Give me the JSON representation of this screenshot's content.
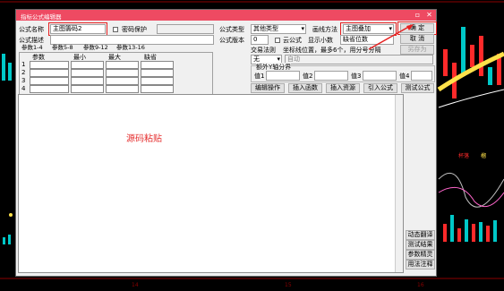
{
  "dialog": {
    "title": "指标公式编辑器",
    "close_glyph": "✕",
    "formula_name_label": "公式名称",
    "formula_name_value": "主图籌码2",
    "password_label": "密码保护",
    "formula_type_label": "公式类型",
    "formula_type_value": "其他类型",
    "draw_method_label": "画线方法",
    "draw_method_value": "主图叠加",
    "ok_button": "确  定",
    "cancel_button": "取  消",
    "save_as_button": "另存为",
    "formula_desc_label": "公式描述",
    "version_label": "公式版本",
    "version_value": "0",
    "cloud_label": "云公式",
    "display_decimals_label": "显示小数",
    "display_decimals_value": "缺省位数",
    "trade_rule_label": "交易法则",
    "coord_label": "坐标线位置，最多6个，用分号分隔",
    "trade_rule_value": "无",
    "auto_label": "自动",
    "extra_y_label": "额外Y轴分界",
    "values": [
      "值1",
      "值2",
      "值3",
      "值4"
    ],
    "tabs": [
      "参数1-4",
      "参数5-8",
      "参数9-12",
      "参数13-16"
    ],
    "param_headers": [
      "参数",
      "最小",
      "最大",
      "缺省"
    ],
    "param_rows": [
      "1",
      "2",
      "3",
      "4"
    ],
    "toolbar": [
      "编辑操作",
      "插入函数",
      "插入资源",
      "引入公式",
      "测试公式"
    ],
    "editor_text": "源码粘贴",
    "side_buttons": [
      "动态翻译",
      "测试结果",
      "参数精灵",
      "用法注释"
    ]
  },
  "background": {
    "axis_labels": [
      "14",
      "15",
      "16"
    ],
    "chart_labels": [
      "杯落",
      "榴"
    ]
  },
  "colors": {
    "accent_red": "#e52020",
    "title_bar": "#ee4a62"
  }
}
